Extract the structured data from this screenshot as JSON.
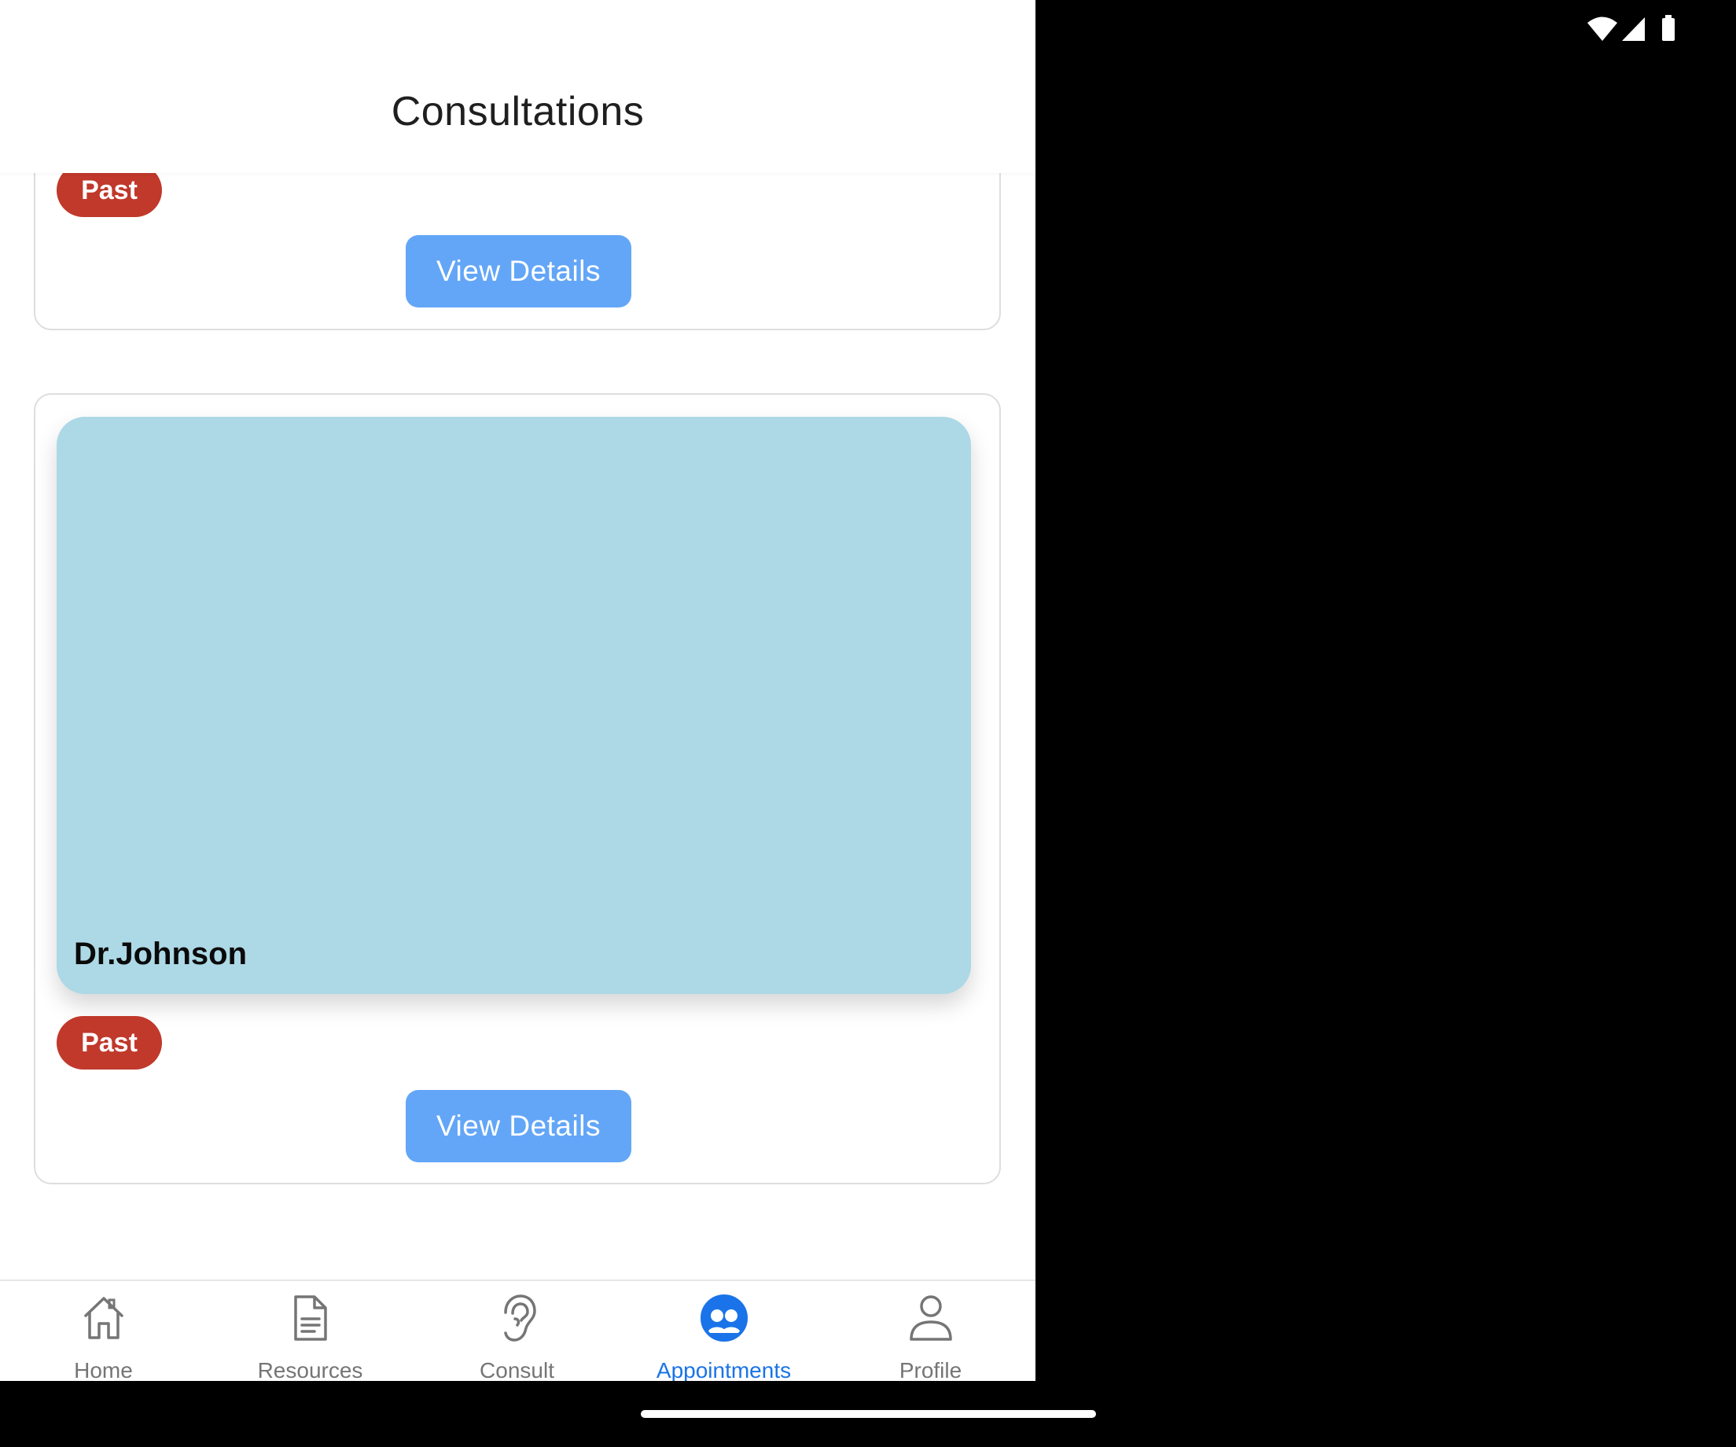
{
  "header": {
    "title": "Consultations"
  },
  "consultations": [
    {
      "status": "Past",
      "action_label": "View Details"
    },
    {
      "doctor": "Dr.Johnson",
      "status": "Past",
      "action_label": "View Details"
    }
  ],
  "tabs": [
    {
      "label": "Home",
      "icon": "home-icon"
    },
    {
      "label": "Resources",
      "icon": "document-icon"
    },
    {
      "label": "Consult",
      "icon": "ear-icon"
    },
    {
      "label": "Appointments",
      "icon": "group-icon",
      "active": true
    },
    {
      "label": "Profile",
      "icon": "person-icon"
    }
  ],
  "colors": {
    "accent": "#1a73e8",
    "badge_past": "#c0392b",
    "button": "#63a6f7",
    "card_image": "#add8e6"
  }
}
